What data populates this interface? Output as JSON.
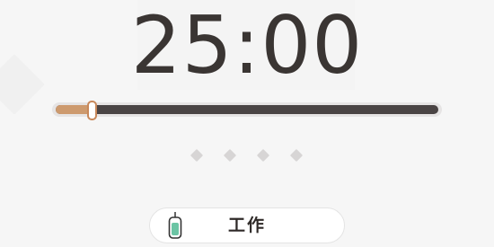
{
  "timer": {
    "display": "25:00"
  },
  "duration_slider": {
    "value_fraction": 0.095
  },
  "session_dots": {
    "count": 4,
    "completed": 0
  },
  "mode": {
    "label": "工作",
    "icon": "tag-icon",
    "icon_color": "#6bc4a4"
  },
  "colors": {
    "accent": "#cd9a6e",
    "text": "#3a3533",
    "rail": "#4a4444"
  }
}
